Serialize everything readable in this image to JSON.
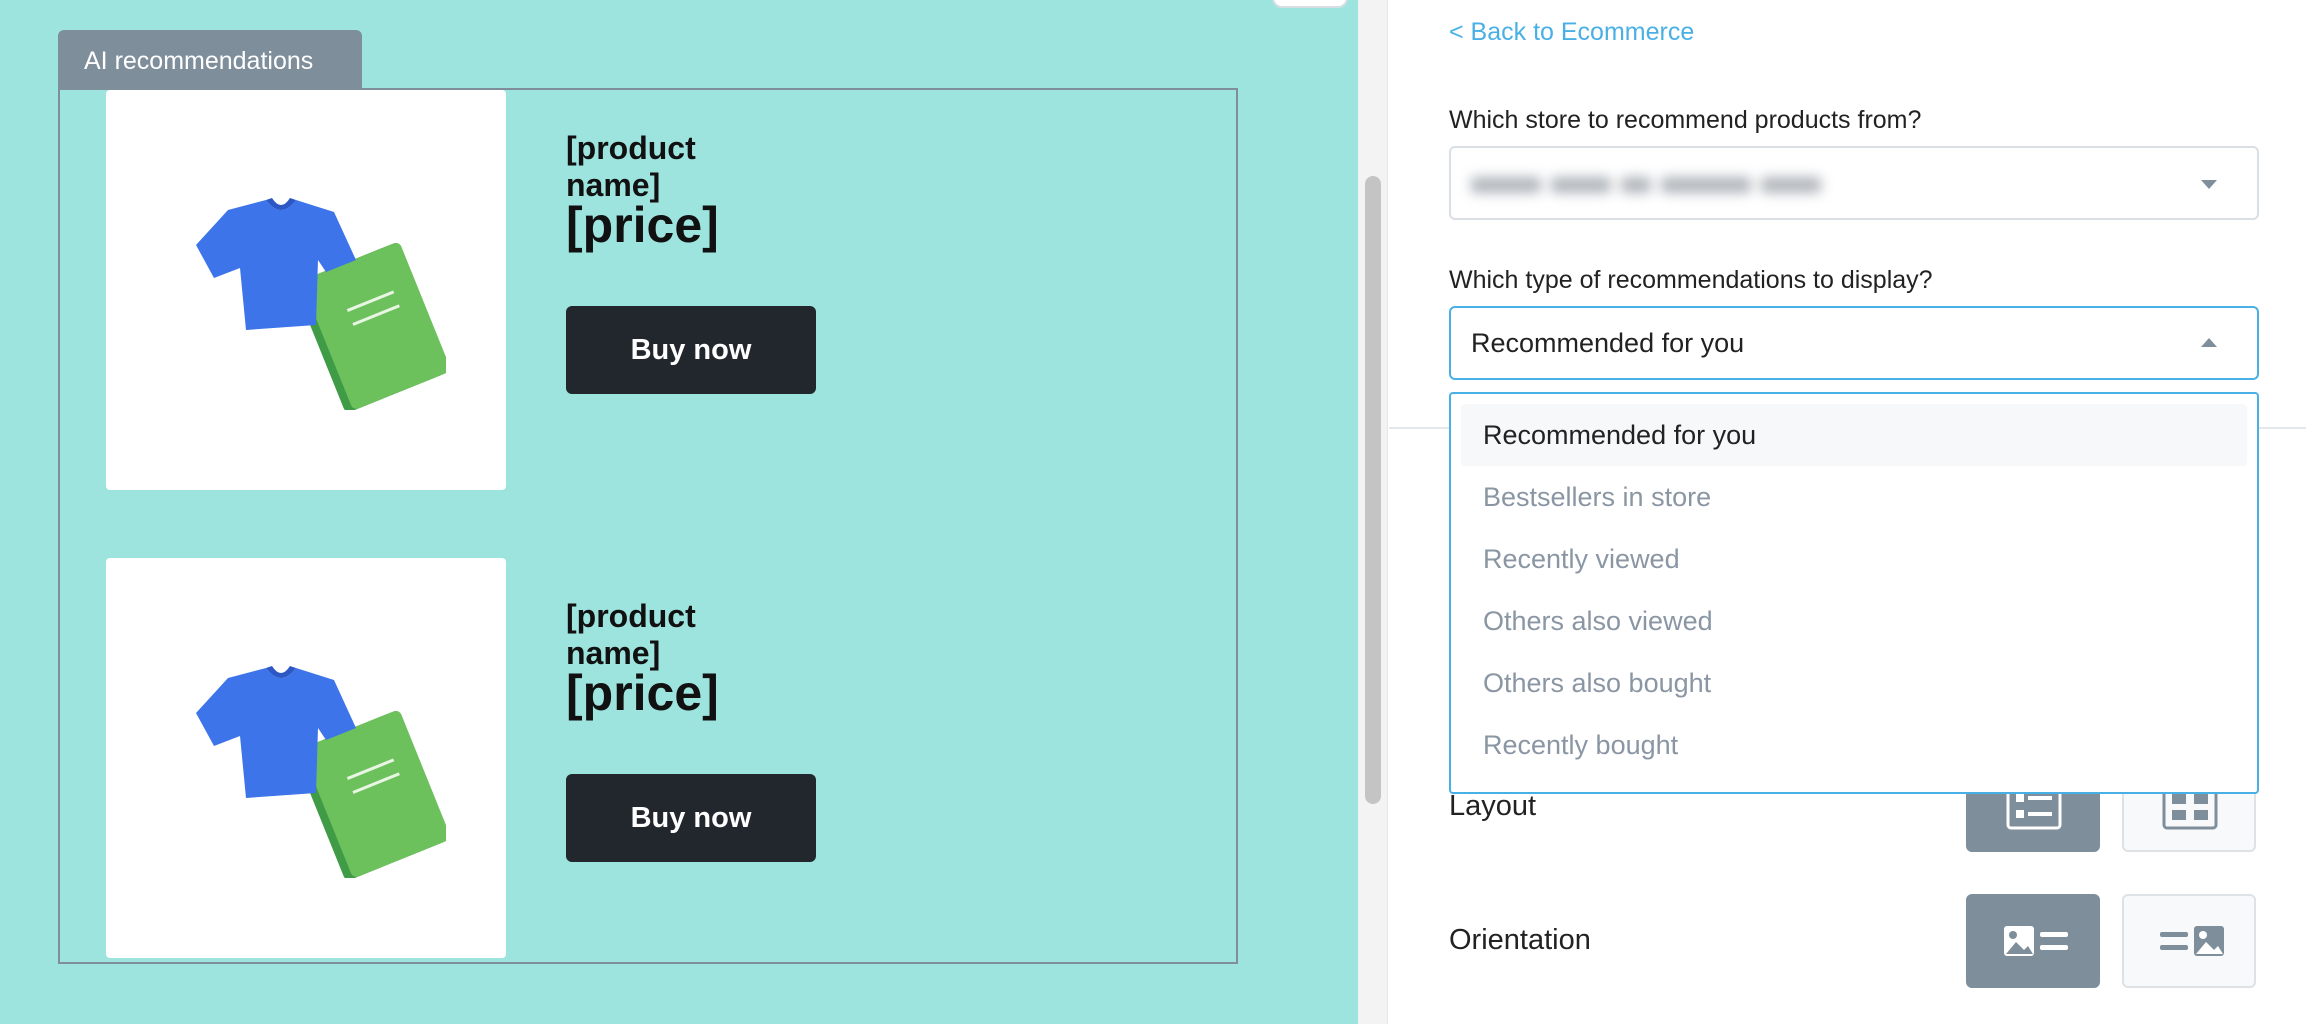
{
  "canvas": {
    "block_tab_label": "AI recommendations",
    "products": [
      {
        "name": "[product name]",
        "price": "[price]",
        "button": "Buy now"
      },
      {
        "name": "[product name]",
        "price": "[price]",
        "button": "Buy now"
      }
    ]
  },
  "panel": {
    "back_link": "< Back to Ecommerce",
    "store_question": "Which store to recommend products from?",
    "type_question": "Which type of recommendations to display?",
    "type_selected": "Recommended for you",
    "dropdown_options": [
      "Recommended for you",
      "Bestsellers in store",
      "Recently viewed",
      "Others also viewed",
      "Others also bought",
      "Recently bought"
    ],
    "layout_label": "Layout",
    "orientation_label": "Orientation"
  },
  "colors": {
    "canvas_bg": "#9de4df",
    "accent": "#49b0e6",
    "tab_gray": "#7f8e9b",
    "button_dark": "#22272e"
  },
  "icons": [
    "tshirt-book-illustration",
    "caret-down-icon",
    "caret-up-icon",
    "list-layout-icon",
    "grid-layout-icon",
    "image-left-icon",
    "image-right-icon"
  ]
}
